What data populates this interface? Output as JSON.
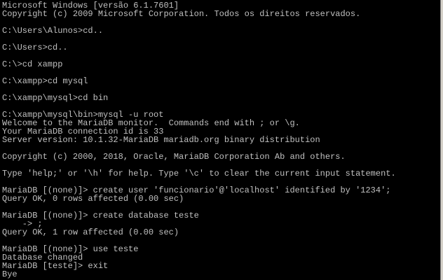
{
  "console": {
    "lines": [
      "Microsoft Windows [versão 6.1.7601]",
      "Copyright (c) 2009 Microsoft Corporation. Todos os direitos reservados.",
      "",
      "C:\\Users\\Alunos>cd..",
      "",
      "C:\\Users>cd..",
      "",
      "C:\\>cd xampp",
      "",
      "C:\\xampp>cd mysql",
      "",
      "C:\\xampp\\mysql>cd bin",
      "",
      "C:\\xampp\\mysql\\bin>mysql -u root",
      "Welcome to the MariaDB monitor.  Commands end with ; or \\g.",
      "Your MariaDB connection id is 33",
      "Server version: 10.1.32-MariaDB mariadb.org binary distribution",
      "",
      "Copyright (c) 2000, 2018, Oracle, MariaDB Corporation Ab and others.",
      "",
      "Type 'help;' or '\\h' for help. Type '\\c' to clear the current input statement.",
      "",
      "MariaDB [(none)]> create user 'funcionario'@'localhost' identified by '1234';",
      "Query OK, 0 rows affected (0.00 sec)",
      "",
      "MariaDB [(none)]> create database teste",
      "    -> ;",
      "Query OK, 1 row affected (0.00 sec)",
      "",
      "MariaDB [(none)]> use teste",
      "Database changed",
      "MariaDB [teste]> exit",
      "Bye"
    ]
  }
}
